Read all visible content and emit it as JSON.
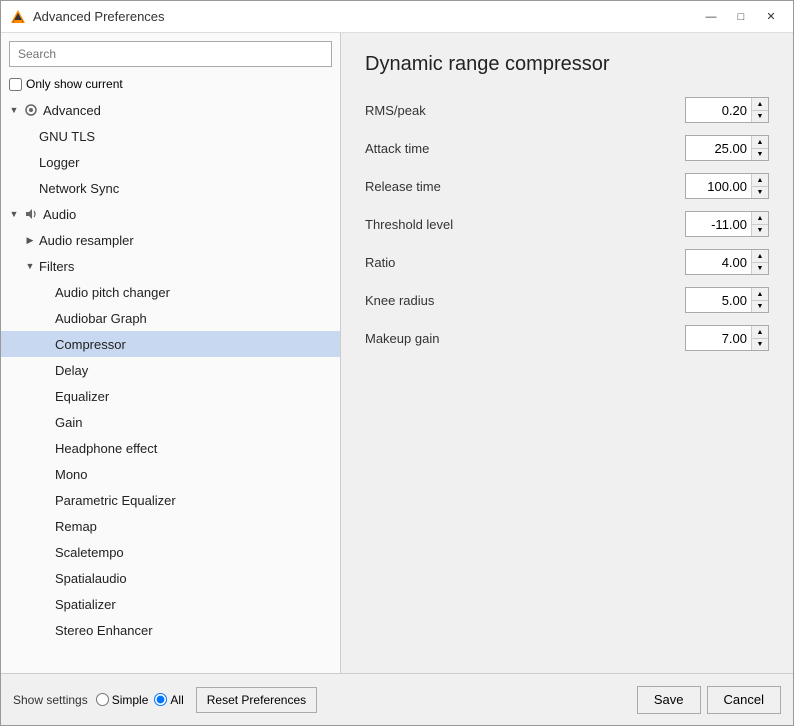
{
  "window": {
    "title": "Advanced Preferences",
    "controls": {
      "minimize": "—",
      "maximize": "□",
      "close": "✕"
    }
  },
  "left_panel": {
    "search_placeholder": "Search",
    "only_show_current_label": "Only show current",
    "tree": [
      {
        "id": "advanced",
        "label": "Advanced",
        "level": 0,
        "expanded": true,
        "has_icon": true,
        "expand_state": "▼"
      },
      {
        "id": "gnu_tls",
        "label": "GNU TLS",
        "level": 1,
        "expanded": false,
        "has_icon": false,
        "expand_state": ""
      },
      {
        "id": "logger",
        "label": "Logger",
        "level": 1,
        "expanded": false,
        "has_icon": false,
        "expand_state": ""
      },
      {
        "id": "network_sync",
        "label": "Network Sync",
        "level": 1,
        "expanded": false,
        "has_icon": false,
        "expand_state": ""
      },
      {
        "id": "audio",
        "label": "Audio",
        "level": 0,
        "expanded": true,
        "has_icon": true,
        "expand_state": "▼"
      },
      {
        "id": "audio_resampler",
        "label": "Audio resampler",
        "level": 1,
        "expanded": false,
        "has_icon": false,
        "expand_state": "▶"
      },
      {
        "id": "filters",
        "label": "Filters",
        "level": 1,
        "expanded": true,
        "has_icon": false,
        "expand_state": "▼"
      },
      {
        "id": "audio_pitch_changer",
        "label": "Audio pitch changer",
        "level": 2,
        "expanded": false,
        "has_icon": false,
        "expand_state": ""
      },
      {
        "id": "audiobar_graph",
        "label": "Audiobar Graph",
        "level": 2,
        "expanded": false,
        "has_icon": false,
        "expand_state": ""
      },
      {
        "id": "compressor",
        "label": "Compressor",
        "level": 2,
        "expanded": false,
        "has_icon": false,
        "expand_state": "",
        "selected": true
      },
      {
        "id": "delay",
        "label": "Delay",
        "level": 2,
        "expanded": false,
        "has_icon": false,
        "expand_state": ""
      },
      {
        "id": "equalizer",
        "label": "Equalizer",
        "level": 2,
        "expanded": false,
        "has_icon": false,
        "expand_state": ""
      },
      {
        "id": "gain",
        "label": "Gain",
        "level": 2,
        "expanded": false,
        "has_icon": false,
        "expand_state": ""
      },
      {
        "id": "headphone_effect",
        "label": "Headphone effect",
        "level": 2,
        "expanded": false,
        "has_icon": false,
        "expand_state": ""
      },
      {
        "id": "mono",
        "label": "Mono",
        "level": 2,
        "expanded": false,
        "has_icon": false,
        "expand_state": ""
      },
      {
        "id": "parametric_equalizer",
        "label": "Parametric Equalizer",
        "level": 2,
        "expanded": false,
        "has_icon": false,
        "expand_state": ""
      },
      {
        "id": "remap",
        "label": "Remap",
        "level": 2,
        "expanded": false,
        "has_icon": false,
        "expand_state": ""
      },
      {
        "id": "scaletempo",
        "label": "Scaletempo",
        "level": 2,
        "expanded": false,
        "has_icon": false,
        "expand_state": ""
      },
      {
        "id": "spatialaudio",
        "label": "Spatialaudio",
        "level": 2,
        "expanded": false,
        "has_icon": false,
        "expand_state": ""
      },
      {
        "id": "spatializer",
        "label": "Spatializer",
        "level": 2,
        "expanded": false,
        "has_icon": false,
        "expand_state": ""
      },
      {
        "id": "stereo_enhancer",
        "label": "Stereo Enhancer",
        "level": 2,
        "expanded": false,
        "has_icon": false,
        "expand_state": ""
      }
    ]
  },
  "right_panel": {
    "title": "Dynamic range compressor",
    "params": [
      {
        "label": "RMS/peak",
        "value": "0.20"
      },
      {
        "label": "Attack time",
        "value": "25.00"
      },
      {
        "label": "Release time",
        "value": "100.00"
      },
      {
        "label": "Threshold level",
        "value": "-11.00"
      },
      {
        "label": "Ratio",
        "value": "4.00"
      },
      {
        "label": "Knee radius",
        "value": "5.00"
      },
      {
        "label": "Makeup gain",
        "value": "7.00"
      }
    ]
  },
  "bottom_bar": {
    "show_settings_label": "Show settings",
    "radio_simple_label": "Simple",
    "radio_all_label": "All",
    "reset_btn_label": "Reset Preferences",
    "save_btn_label": "Save",
    "cancel_btn_label": "Cancel"
  }
}
